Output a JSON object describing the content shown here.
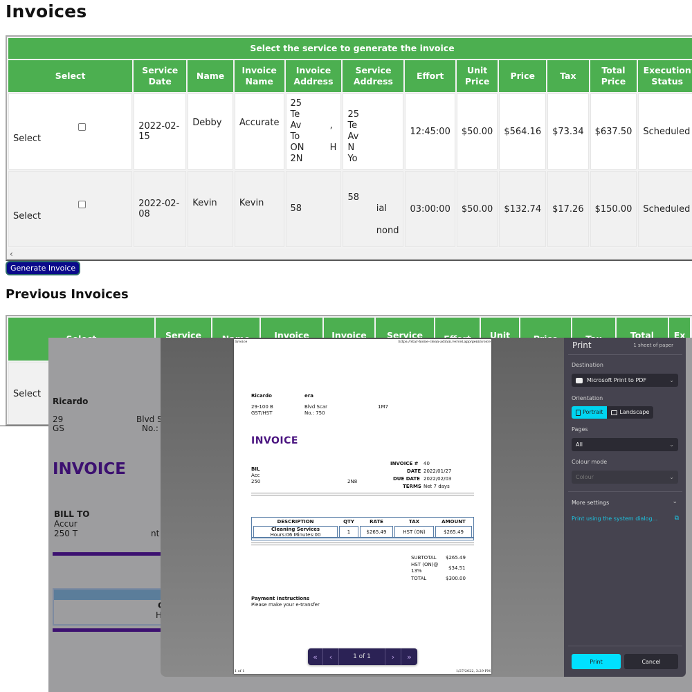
{
  "page": {
    "title": "Invoices",
    "previous_title": "Previous Invoices",
    "generate_button": "Generate Invoice"
  },
  "services_table": {
    "caption": "Select the service to generate the invoice",
    "headers": [
      "Select",
      "Service Date",
      "Name",
      "Invoice Name",
      "Invoice Address",
      "Service Address",
      "Effort",
      "Unit Price",
      "Price",
      "Tax",
      "Total Price",
      "Execution Status"
    ],
    "rows": [
      {
        "select_label": "Select",
        "service_date": "2022-02-15",
        "name": "Debby",
        "invoice_name": "Accurate",
        "invoice_address": "25\nTe\nAv          ,\nTo\nON         H\n2N",
        "service_address": "25\nTe\nAv\nN\nYo",
        "effort": "12:45:00",
        "unit_price": "$50.00",
        "price": "$564.16",
        "tax": "$73.34",
        "total_price": "$637.50",
        "status": "Scheduled"
      },
      {
        "select_label": "Select",
        "service_date": "2022-02-08",
        "name": "Kevin",
        "invoice_name": "Kevin",
        "invoice_address": "58",
        "service_address": "58\n          ial\n\n          nond",
        "effort": "03:00:00",
        "unit_price": "$50.00",
        "price": "$132.74",
        "tax": "$17.26",
        "total_price": "$150.00",
        "status": "Scheduled"
      }
    ],
    "scroll_left": "‹"
  },
  "previous_table": {
    "headers": [
      "Select",
      "Service",
      "Name",
      "Invoice",
      "Invoice",
      "Service",
      "Effort",
      "Unit",
      "Price",
      "Tax",
      "Total",
      "Ex"
    ],
    "rows": [
      {
        "select_label": "Select"
      }
    ]
  },
  "background_doc": {
    "company": "Ricardo",
    "addr1": "29",
    "addr1b": "Blvd S",
    "addr2": "GS",
    "addr2b": "No.:",
    "invoice_title": "INVOICE",
    "bill_to": "BILL TO",
    "bill_line1": "Accur",
    "bill_line2": "250 T",
    "bill_line2b": "nt",
    "item_c": "C",
    "item_h": "H"
  },
  "print_preview": {
    "header_left": "Invoice",
    "header_right": "https://star-home-clean-admin.vercel.app/geninvoice",
    "company": "Ricardo",
    "company_b": "era",
    "addr1": "29-100 B",
    "addr1b": "Blvd Scar",
    "addr1c": "1M7",
    "addr2": "GST/HST",
    "addr2b": "No.: 750",
    "invoice_title": "INVOICE",
    "bill_to": "BIL",
    "bill_line1": "Acc",
    "bill_line2": "250",
    "bill_line2b": "2N8",
    "meta": [
      {
        "label": "INVOICE #",
        "value": "40"
      },
      {
        "label": "DATE",
        "value": "2022/01/27"
      },
      {
        "label": "DUE DATE",
        "value": "2022/02/03"
      },
      {
        "label": "TERMS",
        "value": "Net 7 days"
      }
    ],
    "items_headers": [
      "DESCRIPTION",
      "QTY",
      "RATE",
      "TAX",
      "AMOUNT"
    ],
    "item": {
      "description": "Cleaning Services",
      "detail": "Hours:06 Minutes:00",
      "qty": "1",
      "rate": "$265.49",
      "tax": "HST (ON)",
      "amount": "$265.49"
    },
    "subtotal_label": "SUBTOTAL",
    "subtotal": "$265.49",
    "tax_label": "HST (ON)@",
    "tax_label2": "13%",
    "tax": "$34.51",
    "total_label": "TOTAL",
    "total": "$300.00",
    "payment_title": "Payment Instructions",
    "payment_text": "Please make your e-transfer",
    "footer_left": "1 of 1",
    "footer_right": "1/27/2022, 3:29 PM",
    "pager": {
      "first": "«",
      "prev": "‹",
      "text": "1 of 1",
      "next": "›",
      "last": "»"
    }
  },
  "print_panel": {
    "title": "Print",
    "sheets": "1 sheet of paper",
    "destination_label": "Destination",
    "destination": "Microsoft Print to PDF",
    "orientation_label": "Orientation",
    "portrait": "Portrait",
    "landscape": "Landscape",
    "pages_label": "Pages",
    "pages": "All",
    "colour_label": "Colour mode",
    "colour": "Colour",
    "more_settings": "More settings",
    "system_dialog": "Print using the system dialog...",
    "print_button": "Print",
    "cancel_button": "Cancel",
    "accent": "#00e0ff"
  }
}
